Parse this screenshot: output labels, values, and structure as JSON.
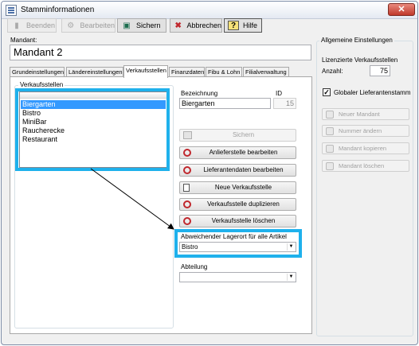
{
  "window": {
    "title": "Stamminformationen",
    "close_label": "✕"
  },
  "toolbar": {
    "beenden": "Beenden",
    "bearbeiten": "Bearbeiten",
    "sichern": "Sichern",
    "abbrechen": "Abbrechen",
    "hilfe": "Hilfe"
  },
  "mandant": {
    "label": "Mandant:",
    "value": "Mandant 2"
  },
  "tabs": [
    "Grundeinstellungen",
    "Ländereinstellungen",
    "Verkaufsstellen",
    "Finanzdaten",
    "Fibu & Lohn",
    "Filialverwaltung"
  ],
  "verkaufsstellen": {
    "group_title": "Verkaufsstellen",
    "items": [
      "Biergarten",
      "Bistro",
      "MiniBar",
      "Raucherecke",
      "Restaurant"
    ],
    "selected": "Biergarten"
  },
  "detail": {
    "bezeichnung_label": "Bezeichnung",
    "id_label": "ID",
    "bezeichnung_value": "Biergarten",
    "id_value": "15"
  },
  "actions": {
    "sichern": "Sichern",
    "anlieferstelle": "Anlieferstelle bearbeiten",
    "lieferantendaten": "Lieferantendaten bearbeiten",
    "neue": "Neue Verkaufsstelle",
    "duplizieren": "Verkaufsstelle duplizieren",
    "loeschen": "Verkaufsstelle löschen"
  },
  "lagerort": {
    "label": "Abweichender Lagerort für alle Artikel",
    "value": "Bistro"
  },
  "abteilung": {
    "label": "Abteilung",
    "value": ""
  },
  "right_panel": {
    "group_title": "Allgemeine Einstellungen",
    "lizenz_label": "Lizenzierte Verkaufsstellen",
    "anzahl_label": "Anzahl:",
    "anzahl_value": "75",
    "global_label": "Globaler Lieferantenstamm",
    "global_checked": true,
    "neuer_mandant": "Neuer Mandant",
    "nummer_aendern": "Nummer ändern",
    "mandant_kopieren": "Mandant kopieren",
    "mandant_loeschen": "Mandant löschen"
  },
  "colors": {
    "highlight": "#1fb1ec",
    "selection": "#3399ff",
    "icon_red": "#c0272d"
  }
}
